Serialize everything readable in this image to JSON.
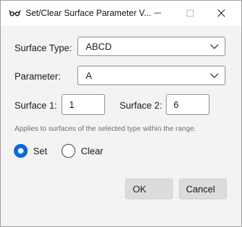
{
  "window": {
    "title": "Set/Clear Surface Parameter V...",
    "icons": {
      "app": "glasses-icon",
      "minimize": "minimize-icon",
      "maximize": "maximize-icon",
      "close": "close-icon"
    }
  },
  "form": {
    "surface_type": {
      "label": "Surface Type:",
      "value": "ABCD"
    },
    "parameter": {
      "label": "Parameter:",
      "value": "A"
    },
    "surface1": {
      "label": "Surface 1:",
      "value": "1"
    },
    "surface2": {
      "label": "Surface 2:",
      "value": "6"
    },
    "hint": "Applies to surfaces of the selected type within the range.",
    "mode": {
      "selected": "Set",
      "options": [
        "Set",
        "Clear"
      ]
    }
  },
  "buttons": {
    "ok": "OK",
    "cancel": "Cancel"
  },
  "colors": {
    "accent": "#0a6bd1",
    "button_bg": "#dcdcdc",
    "window_bg": "#f3f3f3"
  }
}
